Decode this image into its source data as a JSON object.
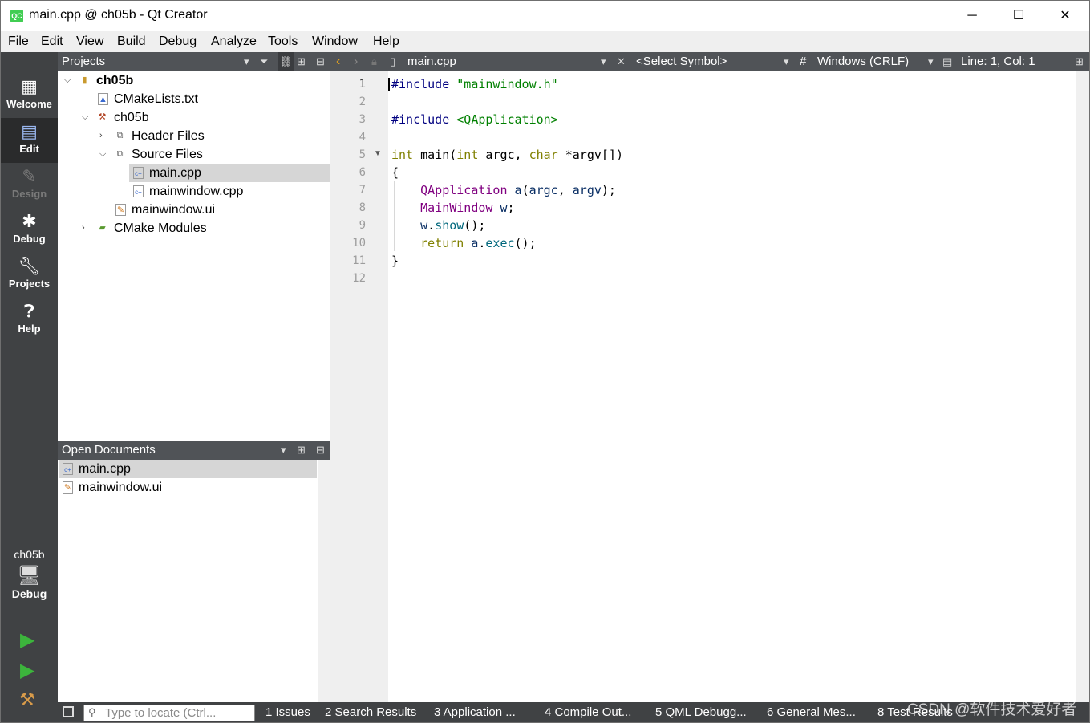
{
  "window": {
    "title": "main.cpp @ ch05b - Qt Creator",
    "app_icon": "QC",
    "minimize": "─",
    "maximize": "☐",
    "close": "✕"
  },
  "menu": [
    "File",
    "Edit",
    "View",
    "Build",
    "Debug",
    "Analyze",
    "Tools",
    "Window",
    "Help"
  ],
  "modes": [
    {
      "label": "Welcome",
      "icon": "grid-icon"
    },
    {
      "label": "Edit",
      "icon": "document-icon"
    },
    {
      "label": "Design",
      "icon": "pencil-icon"
    },
    {
      "label": "Debug",
      "icon": "bug-icon"
    },
    {
      "label": "Projects",
      "icon": "wrench-icon"
    },
    {
      "label": "Help",
      "icon": "question-icon"
    }
  ],
  "kit": {
    "project": "ch05b",
    "mode": "Debug"
  },
  "projects_panel": {
    "title": "Projects",
    "tree": [
      {
        "label": "ch05b"
      },
      {
        "label": "CMakeLists.txt"
      },
      {
        "label": "ch05b"
      },
      {
        "label": "Header Files"
      },
      {
        "label": "Source Files"
      },
      {
        "label": "main.cpp"
      },
      {
        "label": "mainwindow.cpp"
      },
      {
        "label": "mainwindow.ui"
      },
      {
        "label": "CMake Modules"
      }
    ]
  },
  "open_documents": {
    "title": "Open Documents",
    "items": [
      "main.cpp",
      "mainwindow.ui"
    ]
  },
  "editor_toolbar": {
    "file": "main.cpp",
    "symbol": "<Select Symbol>",
    "hash": "#",
    "line_endings": "Windows (CRLF)",
    "position": "Line: 1, Col: 1"
  },
  "editor": {
    "line_numbers": [
      "1",
      "2",
      "3",
      "4",
      "5",
      "6",
      "7",
      "8",
      "9",
      "10",
      "11",
      "12"
    ],
    "lines": [
      "#include \"mainwindow.h\"",
      "",
      "#include <QApplication>",
      "",
      "int main(int argc, char *argv[])",
      "{",
      "    QApplication a(argc, argv);",
      "    MainWindow w;",
      "    w.show();",
      "    return a.exec();",
      "}",
      ""
    ]
  },
  "statusbar": {
    "locator_placeholder": "Type to locate (Ctrl...",
    "panes": [
      "1  Issues",
      "2  Search Results",
      "3  Application ...",
      "4  Compile Out...",
      "5  QML Debugg...",
      "6  General Mes...",
      "8  Test Results"
    ]
  },
  "watermark": "CSDN @软件技术爱好者"
}
